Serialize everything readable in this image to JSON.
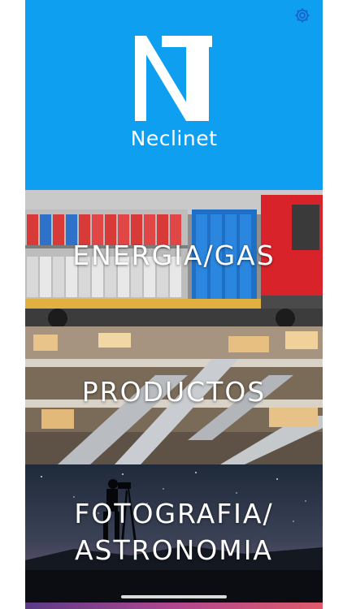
{
  "header": {
    "logo_letters": "NT",
    "app_name": "Neclinet",
    "background_color": "#0e9ff0",
    "settings_icon": "gear-icon"
  },
  "tiles": [
    {
      "label": "ENERGIA/GAS"
    },
    {
      "label": "PRODUCTOS"
    },
    {
      "label_line1": "FOTOGRAFIA/",
      "label_line2": "ASTRONOMIA"
    }
  ]
}
